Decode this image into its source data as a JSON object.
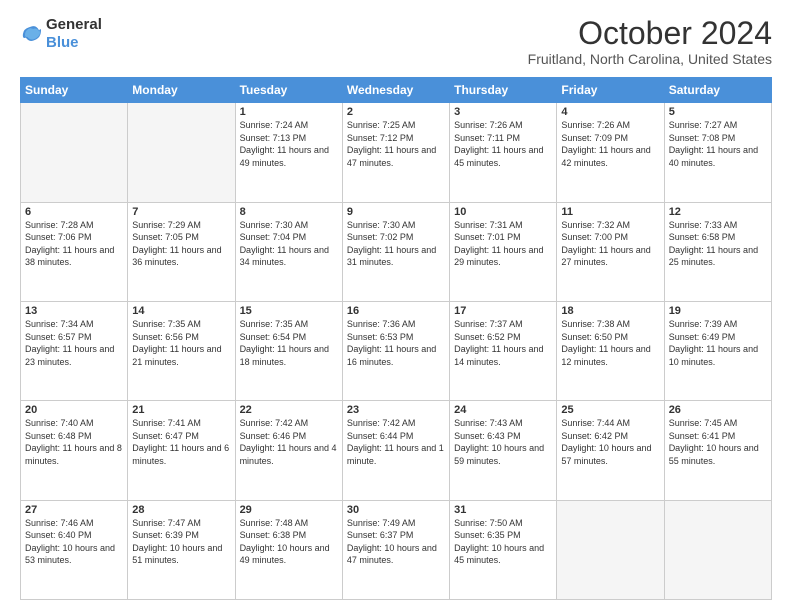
{
  "logo": {
    "general": "General",
    "blue": "Blue"
  },
  "header": {
    "month": "October 2024",
    "location": "Fruitland, North Carolina, United States"
  },
  "weekdays": [
    "Sunday",
    "Monday",
    "Tuesday",
    "Wednesday",
    "Thursday",
    "Friday",
    "Saturday"
  ],
  "weeks": [
    [
      {
        "day": "",
        "empty": true
      },
      {
        "day": "",
        "empty": true
      },
      {
        "day": "1",
        "sunrise": "7:24 AM",
        "sunset": "7:13 PM",
        "daylight": "11 hours and 49 minutes."
      },
      {
        "day": "2",
        "sunrise": "7:25 AM",
        "sunset": "7:12 PM",
        "daylight": "11 hours and 47 minutes."
      },
      {
        "day": "3",
        "sunrise": "7:26 AM",
        "sunset": "7:11 PM",
        "daylight": "11 hours and 45 minutes."
      },
      {
        "day": "4",
        "sunrise": "7:26 AM",
        "sunset": "7:09 PM",
        "daylight": "11 hours and 42 minutes."
      },
      {
        "day": "5",
        "sunrise": "7:27 AM",
        "sunset": "7:08 PM",
        "daylight": "11 hours and 40 minutes."
      }
    ],
    [
      {
        "day": "6",
        "sunrise": "7:28 AM",
        "sunset": "7:06 PM",
        "daylight": "11 hours and 38 minutes."
      },
      {
        "day": "7",
        "sunrise": "7:29 AM",
        "sunset": "7:05 PM",
        "daylight": "11 hours and 36 minutes."
      },
      {
        "day": "8",
        "sunrise": "7:30 AM",
        "sunset": "7:04 PM",
        "daylight": "11 hours and 34 minutes."
      },
      {
        "day": "9",
        "sunrise": "7:30 AM",
        "sunset": "7:02 PM",
        "daylight": "11 hours and 31 minutes."
      },
      {
        "day": "10",
        "sunrise": "7:31 AM",
        "sunset": "7:01 PM",
        "daylight": "11 hours and 29 minutes."
      },
      {
        "day": "11",
        "sunrise": "7:32 AM",
        "sunset": "7:00 PM",
        "daylight": "11 hours and 27 minutes."
      },
      {
        "day": "12",
        "sunrise": "7:33 AM",
        "sunset": "6:58 PM",
        "daylight": "11 hours and 25 minutes."
      }
    ],
    [
      {
        "day": "13",
        "sunrise": "7:34 AM",
        "sunset": "6:57 PM",
        "daylight": "11 hours and 23 minutes."
      },
      {
        "day": "14",
        "sunrise": "7:35 AM",
        "sunset": "6:56 PM",
        "daylight": "11 hours and 21 minutes."
      },
      {
        "day": "15",
        "sunrise": "7:35 AM",
        "sunset": "6:54 PM",
        "daylight": "11 hours and 18 minutes."
      },
      {
        "day": "16",
        "sunrise": "7:36 AM",
        "sunset": "6:53 PM",
        "daylight": "11 hours and 16 minutes."
      },
      {
        "day": "17",
        "sunrise": "7:37 AM",
        "sunset": "6:52 PM",
        "daylight": "11 hours and 14 minutes."
      },
      {
        "day": "18",
        "sunrise": "7:38 AM",
        "sunset": "6:50 PM",
        "daylight": "11 hours and 12 minutes."
      },
      {
        "day": "19",
        "sunrise": "7:39 AM",
        "sunset": "6:49 PM",
        "daylight": "11 hours and 10 minutes."
      }
    ],
    [
      {
        "day": "20",
        "sunrise": "7:40 AM",
        "sunset": "6:48 PM",
        "daylight": "11 hours and 8 minutes."
      },
      {
        "day": "21",
        "sunrise": "7:41 AM",
        "sunset": "6:47 PM",
        "daylight": "11 hours and 6 minutes."
      },
      {
        "day": "22",
        "sunrise": "7:42 AM",
        "sunset": "6:46 PM",
        "daylight": "11 hours and 4 minutes."
      },
      {
        "day": "23",
        "sunrise": "7:42 AM",
        "sunset": "6:44 PM",
        "daylight": "11 hours and 1 minute."
      },
      {
        "day": "24",
        "sunrise": "7:43 AM",
        "sunset": "6:43 PM",
        "daylight": "10 hours and 59 minutes."
      },
      {
        "day": "25",
        "sunrise": "7:44 AM",
        "sunset": "6:42 PM",
        "daylight": "10 hours and 57 minutes."
      },
      {
        "day": "26",
        "sunrise": "7:45 AM",
        "sunset": "6:41 PM",
        "daylight": "10 hours and 55 minutes."
      }
    ],
    [
      {
        "day": "27",
        "sunrise": "7:46 AM",
        "sunset": "6:40 PM",
        "daylight": "10 hours and 53 minutes."
      },
      {
        "day": "28",
        "sunrise": "7:47 AM",
        "sunset": "6:39 PM",
        "daylight": "10 hours and 51 minutes."
      },
      {
        "day": "29",
        "sunrise": "7:48 AM",
        "sunset": "6:38 PM",
        "daylight": "10 hours and 49 minutes."
      },
      {
        "day": "30",
        "sunrise": "7:49 AM",
        "sunset": "6:37 PM",
        "daylight": "10 hours and 47 minutes."
      },
      {
        "day": "31",
        "sunrise": "7:50 AM",
        "sunset": "6:35 PM",
        "daylight": "10 hours and 45 minutes."
      },
      {
        "day": "",
        "empty": true
      },
      {
        "day": "",
        "empty": true
      }
    ]
  ]
}
